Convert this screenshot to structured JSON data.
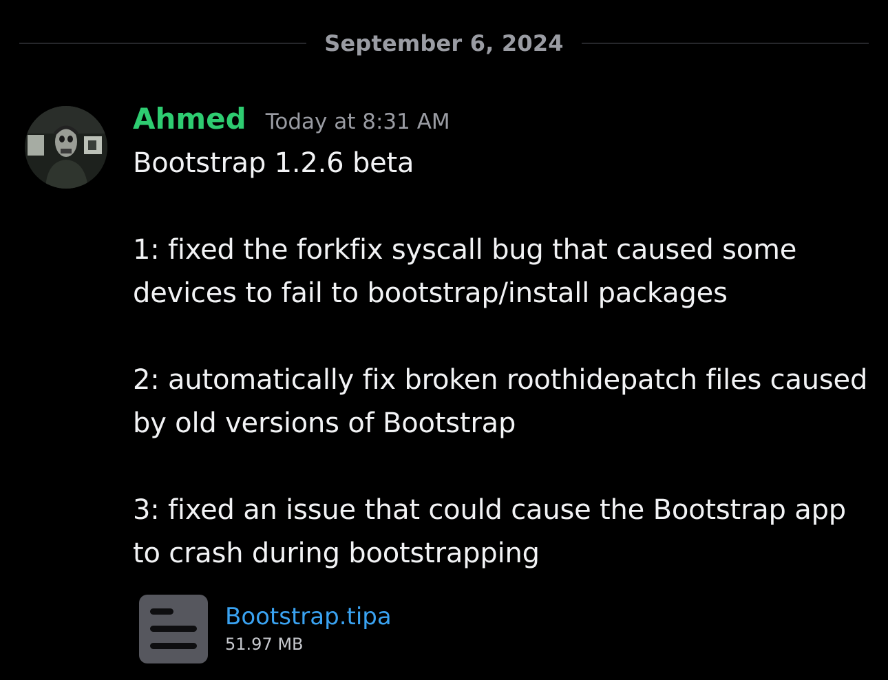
{
  "divider": {
    "date": "September 6, 2024"
  },
  "message": {
    "author": "Ahmed",
    "author_color": "#2ecc71",
    "timestamp": "Today at 8:31 AM",
    "title": "Bootstrap 1.2.6 beta",
    "items": [
      "1: fixed the forkfix syscall bug that caused some devices to fail to bootstrap/install packages",
      "2: automatically fix broken roothidepatch files caused by old versions of Bootstrap",
      "3: fixed an issue that could cause the Bootstrap app to crash during bootstrapping"
    ]
  },
  "attachment": {
    "icon": "file-icon",
    "filename": "Bootstrap.tipa",
    "size": "51.97 MB",
    "link_color": "#3aa3f2"
  },
  "colors": {
    "background": "#000000",
    "text": "#f2f3f5",
    "muted": "#9a9ca3"
  }
}
